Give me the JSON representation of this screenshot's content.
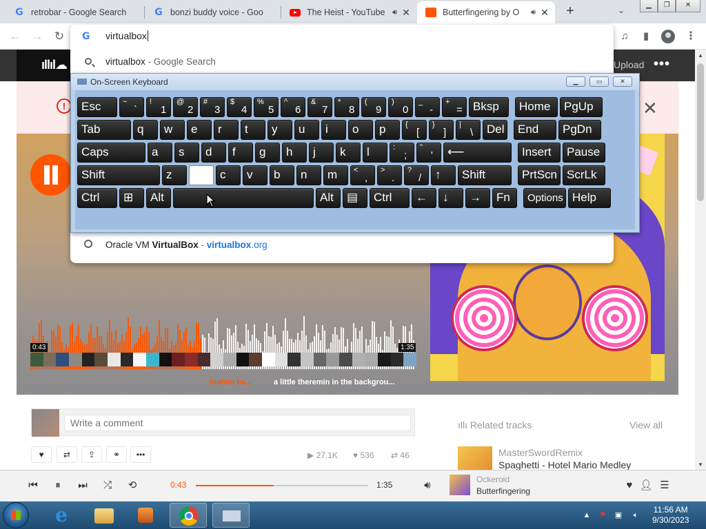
{
  "browser": {
    "tabs": [
      {
        "title": "retrobar - Google Search",
        "icon": "google-icon"
      },
      {
        "title": "bonzi buddy voice - Goo",
        "icon": "google-icon"
      },
      {
        "title": "The Heist - YouTube",
        "icon": "youtube-icon",
        "audio": true
      },
      {
        "title": "Butterfingering by O",
        "icon": "soundcloud-icon",
        "audio": true,
        "active": true
      }
    ],
    "new_tab": "+",
    "address_input": "virtualbox"
  },
  "omnibox": {
    "suggestions": [
      {
        "icon": "search-icon",
        "query": "virtualbox",
        "suffix": " - Google Search"
      },
      {
        "icon": "globe-icon",
        "prefix": "Oracle VM ",
        "bold": "VirtualBox",
        "sep": " - ",
        "url_bold": "virtualbox",
        "url_rest": ".org"
      }
    ]
  },
  "soundcloud": {
    "header": {
      "upload": "Upload",
      "more": "•••"
    },
    "waveform": {
      "elapsed": "0:43",
      "duration": "1:35",
      "comment_left": "human ba...",
      "comment_right": "a little theremin in the backgrou..."
    },
    "comment_placeholder": "Write a comment",
    "stats": {
      "plays": "27.1K",
      "likes": "536",
      "reposts": "46"
    },
    "related": {
      "heading": "Related tracks",
      "view_all": "View all",
      "user": "MasterSwordRemix",
      "title": "Spaghetti - Hotel Mario Medley"
    }
  },
  "player": {
    "elapsed": "0:43",
    "duration": "1:35",
    "progress": 0.45,
    "user": "Ockeroid",
    "title": "Butterfingering"
  },
  "keyboard": {
    "title": "On-Screen Keyboard",
    "rows": [
      [
        {
          "m": "Esc",
          "w": 60
        },
        {
          "s": "~",
          "b": "`",
          "w": 38
        },
        {
          "s": "!",
          "b": "1",
          "w": 38
        },
        {
          "s": "@",
          "b": "2",
          "w": 38
        },
        {
          "s": "#",
          "b": "3",
          "w": 38
        },
        {
          "s": "$",
          "b": "4",
          "w": 38
        },
        {
          "s": "%",
          "b": "5",
          "w": 38
        },
        {
          "s": "^",
          "b": "6",
          "w": 38
        },
        {
          "s": "&",
          "b": "7",
          "w": 38
        },
        {
          "s": "*",
          "b": "8",
          "w": 38
        },
        {
          "s": "(",
          "b": "9",
          "w": 38
        },
        {
          "s": ")",
          "b": "0",
          "w": 38
        },
        {
          "s": "_",
          "b": "-",
          "w": 38
        },
        {
          "s": "+",
          "b": "=",
          "w": 38
        },
        {
          "m": "Bksp",
          "w": 60
        },
        {
          "gap": 6
        },
        {
          "m": "Home",
          "w": 64
        },
        {
          "m": "PgUp",
          "w": 64
        }
      ],
      [
        {
          "m": "Tab",
          "w": 80
        },
        {
          "m": "q",
          "w": 38
        },
        {
          "m": "w",
          "w": 38
        },
        {
          "m": "e",
          "w": 38
        },
        {
          "m": "r",
          "w": 38
        },
        {
          "m": "t",
          "w": 38
        },
        {
          "m": "y",
          "w": 38
        },
        {
          "m": "u",
          "w": 38
        },
        {
          "m": "i",
          "w": 38
        },
        {
          "m": "o",
          "w": 38
        },
        {
          "m": "p",
          "w": 38
        },
        {
          "s": "{",
          "b": "[",
          "w": 38
        },
        {
          "s": "}",
          "b": "]",
          "w": 38
        },
        {
          "s": "|",
          "b": "\\",
          "w": 38
        },
        {
          "m": "Del",
          "w": 38
        },
        {
          "gap": 6
        },
        {
          "m": "End",
          "w": 64
        },
        {
          "m": "PgDn",
          "w": 64
        }
      ],
      [
        {
          "m": "Caps",
          "w": 101
        },
        {
          "m": "a",
          "w": 38
        },
        {
          "m": "s",
          "w": 38
        },
        {
          "m": "d",
          "w": 38
        },
        {
          "m": "f",
          "w": 38
        },
        {
          "m": "g",
          "w": 38
        },
        {
          "m": "h",
          "w": 38
        },
        {
          "m": "j",
          "w": 38
        },
        {
          "m": "k",
          "w": 38
        },
        {
          "m": "l",
          "w": 38
        },
        {
          "s": ":",
          "b": ";",
          "w": 38
        },
        {
          "s": "\"",
          "b": "'",
          "w": 38
        },
        {
          "m": "⟵",
          "w": 101
        },
        {
          "gap": 6
        },
        {
          "m": "Insert",
          "w": 64
        },
        {
          "m": "Pause",
          "w": 64
        }
      ],
      [
        {
          "m": "Shift",
          "w": 122
        },
        {
          "m": "z",
          "w": 38
        },
        {
          "m": "",
          "w": 38,
          "white": true
        },
        {
          "m": "c",
          "w": 38
        },
        {
          "m": "v",
          "w": 38
        },
        {
          "m": "b",
          "w": 38
        },
        {
          "m": "n",
          "w": 38
        },
        {
          "m": "m",
          "w": 38
        },
        {
          "s": "<",
          "b": ",",
          "w": 38
        },
        {
          "s": ">",
          "b": ".",
          "w": 38
        },
        {
          "s": "?",
          "b": "/",
          "w": 38
        },
        {
          "m": "↑",
          "w": 38
        },
        {
          "m": "Shift",
          "w": 80
        },
        {
          "gap": 6
        },
        {
          "m": "PrtScn",
          "w": 64
        },
        {
          "m": "ScrLk",
          "w": 64
        }
      ],
      [
        {
          "m": "Ctrl",
          "w": 60
        },
        {
          "m": "⊞",
          "w": 38
        },
        {
          "m": "Alt",
          "w": 38
        },
        {
          "m": "",
          "w": 206
        },
        {
          "m": "Alt",
          "w": 38
        },
        {
          "m": "▤",
          "w": 38
        },
        {
          "m": "Ctrl",
          "w": 60
        },
        {
          "m": "←",
          "w": 38
        },
        {
          "m": "↓",
          "w": 38
        },
        {
          "m": "→",
          "w": 38
        },
        {
          "m": "Fn",
          "w": 38
        },
        {
          "gap": 6
        },
        {
          "m": "Options",
          "w": 64,
          "small": true
        },
        {
          "m": "Help",
          "w": 64
        }
      ]
    ]
  },
  "taskbar": {
    "time": "11:56 AM",
    "date": "9/30/2023"
  }
}
